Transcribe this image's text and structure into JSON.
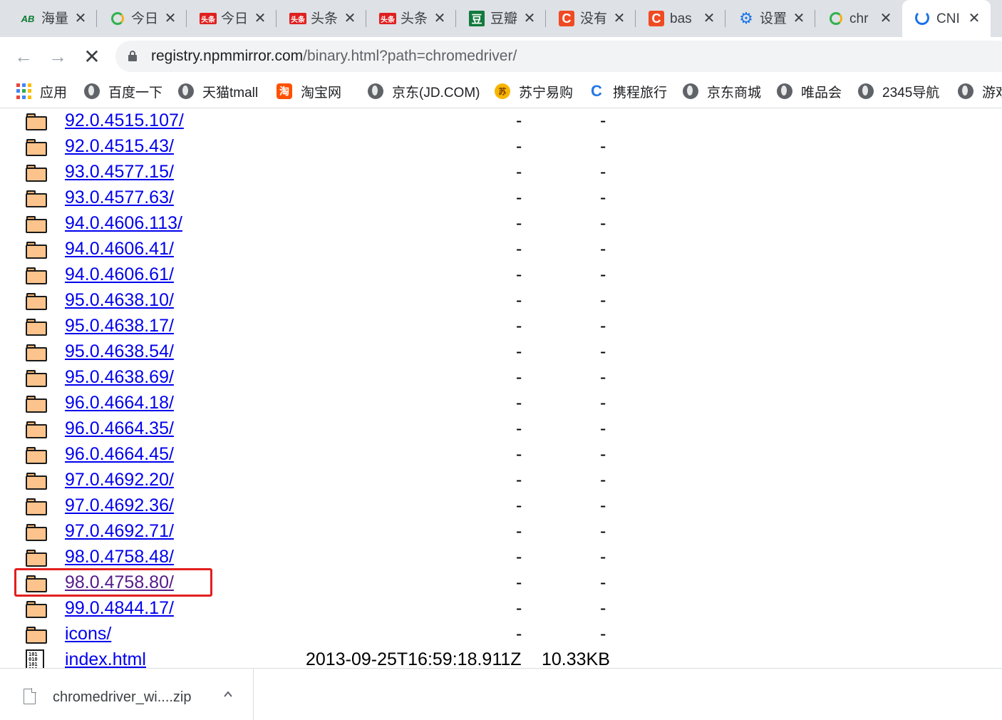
{
  "tabs": [
    {
      "title": "海量",
      "icon": "ab-icon",
      "glyph": "AB"
    },
    {
      "title": "今日",
      "icon": "ring-icon",
      "glyph": ""
    },
    {
      "title": "今日",
      "icon": "toutiao-icon",
      "glyph": "头条"
    },
    {
      "title": "头条",
      "icon": "toutiao-icon",
      "glyph": "头条"
    },
    {
      "title": "头条",
      "icon": "toutiao-icon",
      "glyph": "头条"
    },
    {
      "title": "豆瓣",
      "icon": "douban-icon",
      "glyph": "豆"
    },
    {
      "title": "没有",
      "icon": "csdn-icon",
      "glyph": "C"
    },
    {
      "title": "bas",
      "icon": "csdn-icon",
      "glyph": "C"
    },
    {
      "title": "设置",
      "icon": "gear-icon",
      "glyph": "⚙"
    },
    {
      "title": "chr",
      "icon": "ring-icon",
      "glyph": ""
    },
    {
      "title": "CNI",
      "icon": "loading-spinner-icon",
      "glyph": "",
      "active": true
    }
  ],
  "toolbar": {
    "back_icon": "←",
    "forward_icon": "→",
    "stop_icon": "✕",
    "url_host": "registry.npmmirror.com",
    "url_path": "/binary.html?path=chromedriver/"
  },
  "bookmarks": [
    {
      "label": "应用",
      "icon": "apps-grid-icon"
    },
    {
      "label": "百度一下",
      "icon": "globe-icon"
    },
    {
      "label": "天猫tmall",
      "icon": "globe-icon"
    },
    {
      "label": "淘宝网",
      "icon": "taobao-icon",
      "glyph": "淘"
    },
    {
      "label": "京东(JD.COM)",
      "icon": "globe-icon"
    },
    {
      "label": "苏宁易购",
      "icon": "suning-icon",
      "glyph": "苏"
    },
    {
      "label": "携程旅行",
      "icon": "ctrip-icon",
      "glyph": "C"
    },
    {
      "label": "京东商城",
      "icon": "globe-icon"
    },
    {
      "label": "唯品会",
      "icon": "globe-icon"
    },
    {
      "label": "2345导航",
      "icon": "globe-icon"
    },
    {
      "label": "游戏",
      "icon": "globe-icon"
    }
  ],
  "listing": [
    {
      "name": "92.0.4515.107/",
      "type": "folder",
      "date": "",
      "col3": "-",
      "size": "",
      "col5": "-"
    },
    {
      "name": "92.0.4515.43/",
      "type": "folder",
      "date": "",
      "col3": "-",
      "size": "",
      "col5": "-"
    },
    {
      "name": "93.0.4577.15/",
      "type": "folder",
      "date": "",
      "col3": "-",
      "size": "",
      "col5": "-"
    },
    {
      "name": "93.0.4577.63/",
      "type": "folder",
      "date": "",
      "col3": "-",
      "size": "",
      "col5": "-"
    },
    {
      "name": "94.0.4606.113/",
      "type": "folder",
      "date": "",
      "col3": "-",
      "size": "",
      "col5": "-"
    },
    {
      "name": "94.0.4606.41/",
      "type": "folder",
      "date": "",
      "col3": "-",
      "size": "",
      "col5": "-"
    },
    {
      "name": "94.0.4606.61/",
      "type": "folder",
      "date": "",
      "col3": "-",
      "size": "",
      "col5": "-"
    },
    {
      "name": "95.0.4638.10/",
      "type": "folder",
      "date": "",
      "col3": "-",
      "size": "",
      "col5": "-"
    },
    {
      "name": "95.0.4638.17/",
      "type": "folder",
      "date": "",
      "col3": "-",
      "size": "",
      "col5": "-"
    },
    {
      "name": "95.0.4638.54/",
      "type": "folder",
      "date": "",
      "col3": "-",
      "size": "",
      "col5": "-"
    },
    {
      "name": "95.0.4638.69/",
      "type": "folder",
      "date": "",
      "col3": "-",
      "size": "",
      "col5": "-"
    },
    {
      "name": "96.0.4664.18/",
      "type": "folder",
      "date": "",
      "col3": "-",
      "size": "",
      "col5": "-"
    },
    {
      "name": "96.0.4664.35/",
      "type": "folder",
      "date": "",
      "col3": "-",
      "size": "",
      "col5": "-"
    },
    {
      "name": "96.0.4664.45/",
      "type": "folder",
      "date": "",
      "col3": "-",
      "size": "",
      "col5": "-"
    },
    {
      "name": "97.0.4692.20/",
      "type": "folder",
      "date": "",
      "col3": "-",
      "size": "",
      "col5": "-"
    },
    {
      "name": "97.0.4692.36/",
      "type": "folder",
      "date": "",
      "col3": "-",
      "size": "",
      "col5": "-"
    },
    {
      "name": "97.0.4692.71/",
      "type": "folder",
      "date": "",
      "col3": "-",
      "size": "",
      "col5": "-"
    },
    {
      "name": "98.0.4758.48/",
      "type": "folder",
      "date": "",
      "col3": "-",
      "size": "",
      "col5": "-"
    },
    {
      "name": "98.0.4758.80/",
      "type": "folder",
      "date": "",
      "col3": "-",
      "size": "",
      "col5": "-",
      "visited": true
    },
    {
      "name": "99.0.4844.17/",
      "type": "folder",
      "date": "",
      "col3": "-",
      "size": "",
      "col5": "-"
    },
    {
      "name": "icons/",
      "type": "folder",
      "date": "",
      "col3": "-",
      "size": "",
      "col5": "-"
    },
    {
      "name": "index.html",
      "type": "file",
      "date": "2013-09-25T16:59:18.911Z",
      "col3": "",
      "size": "10.33KB",
      "col5": ""
    }
  ],
  "download_shelf": {
    "filename": "chromedriver_wi....zip",
    "chevron": "^"
  },
  "colors": {
    "link": "#0000ee",
    "visited_link": "#551a8b",
    "highlight_box": "#e21f1f",
    "folder_fill": "#fcc48c"
  }
}
